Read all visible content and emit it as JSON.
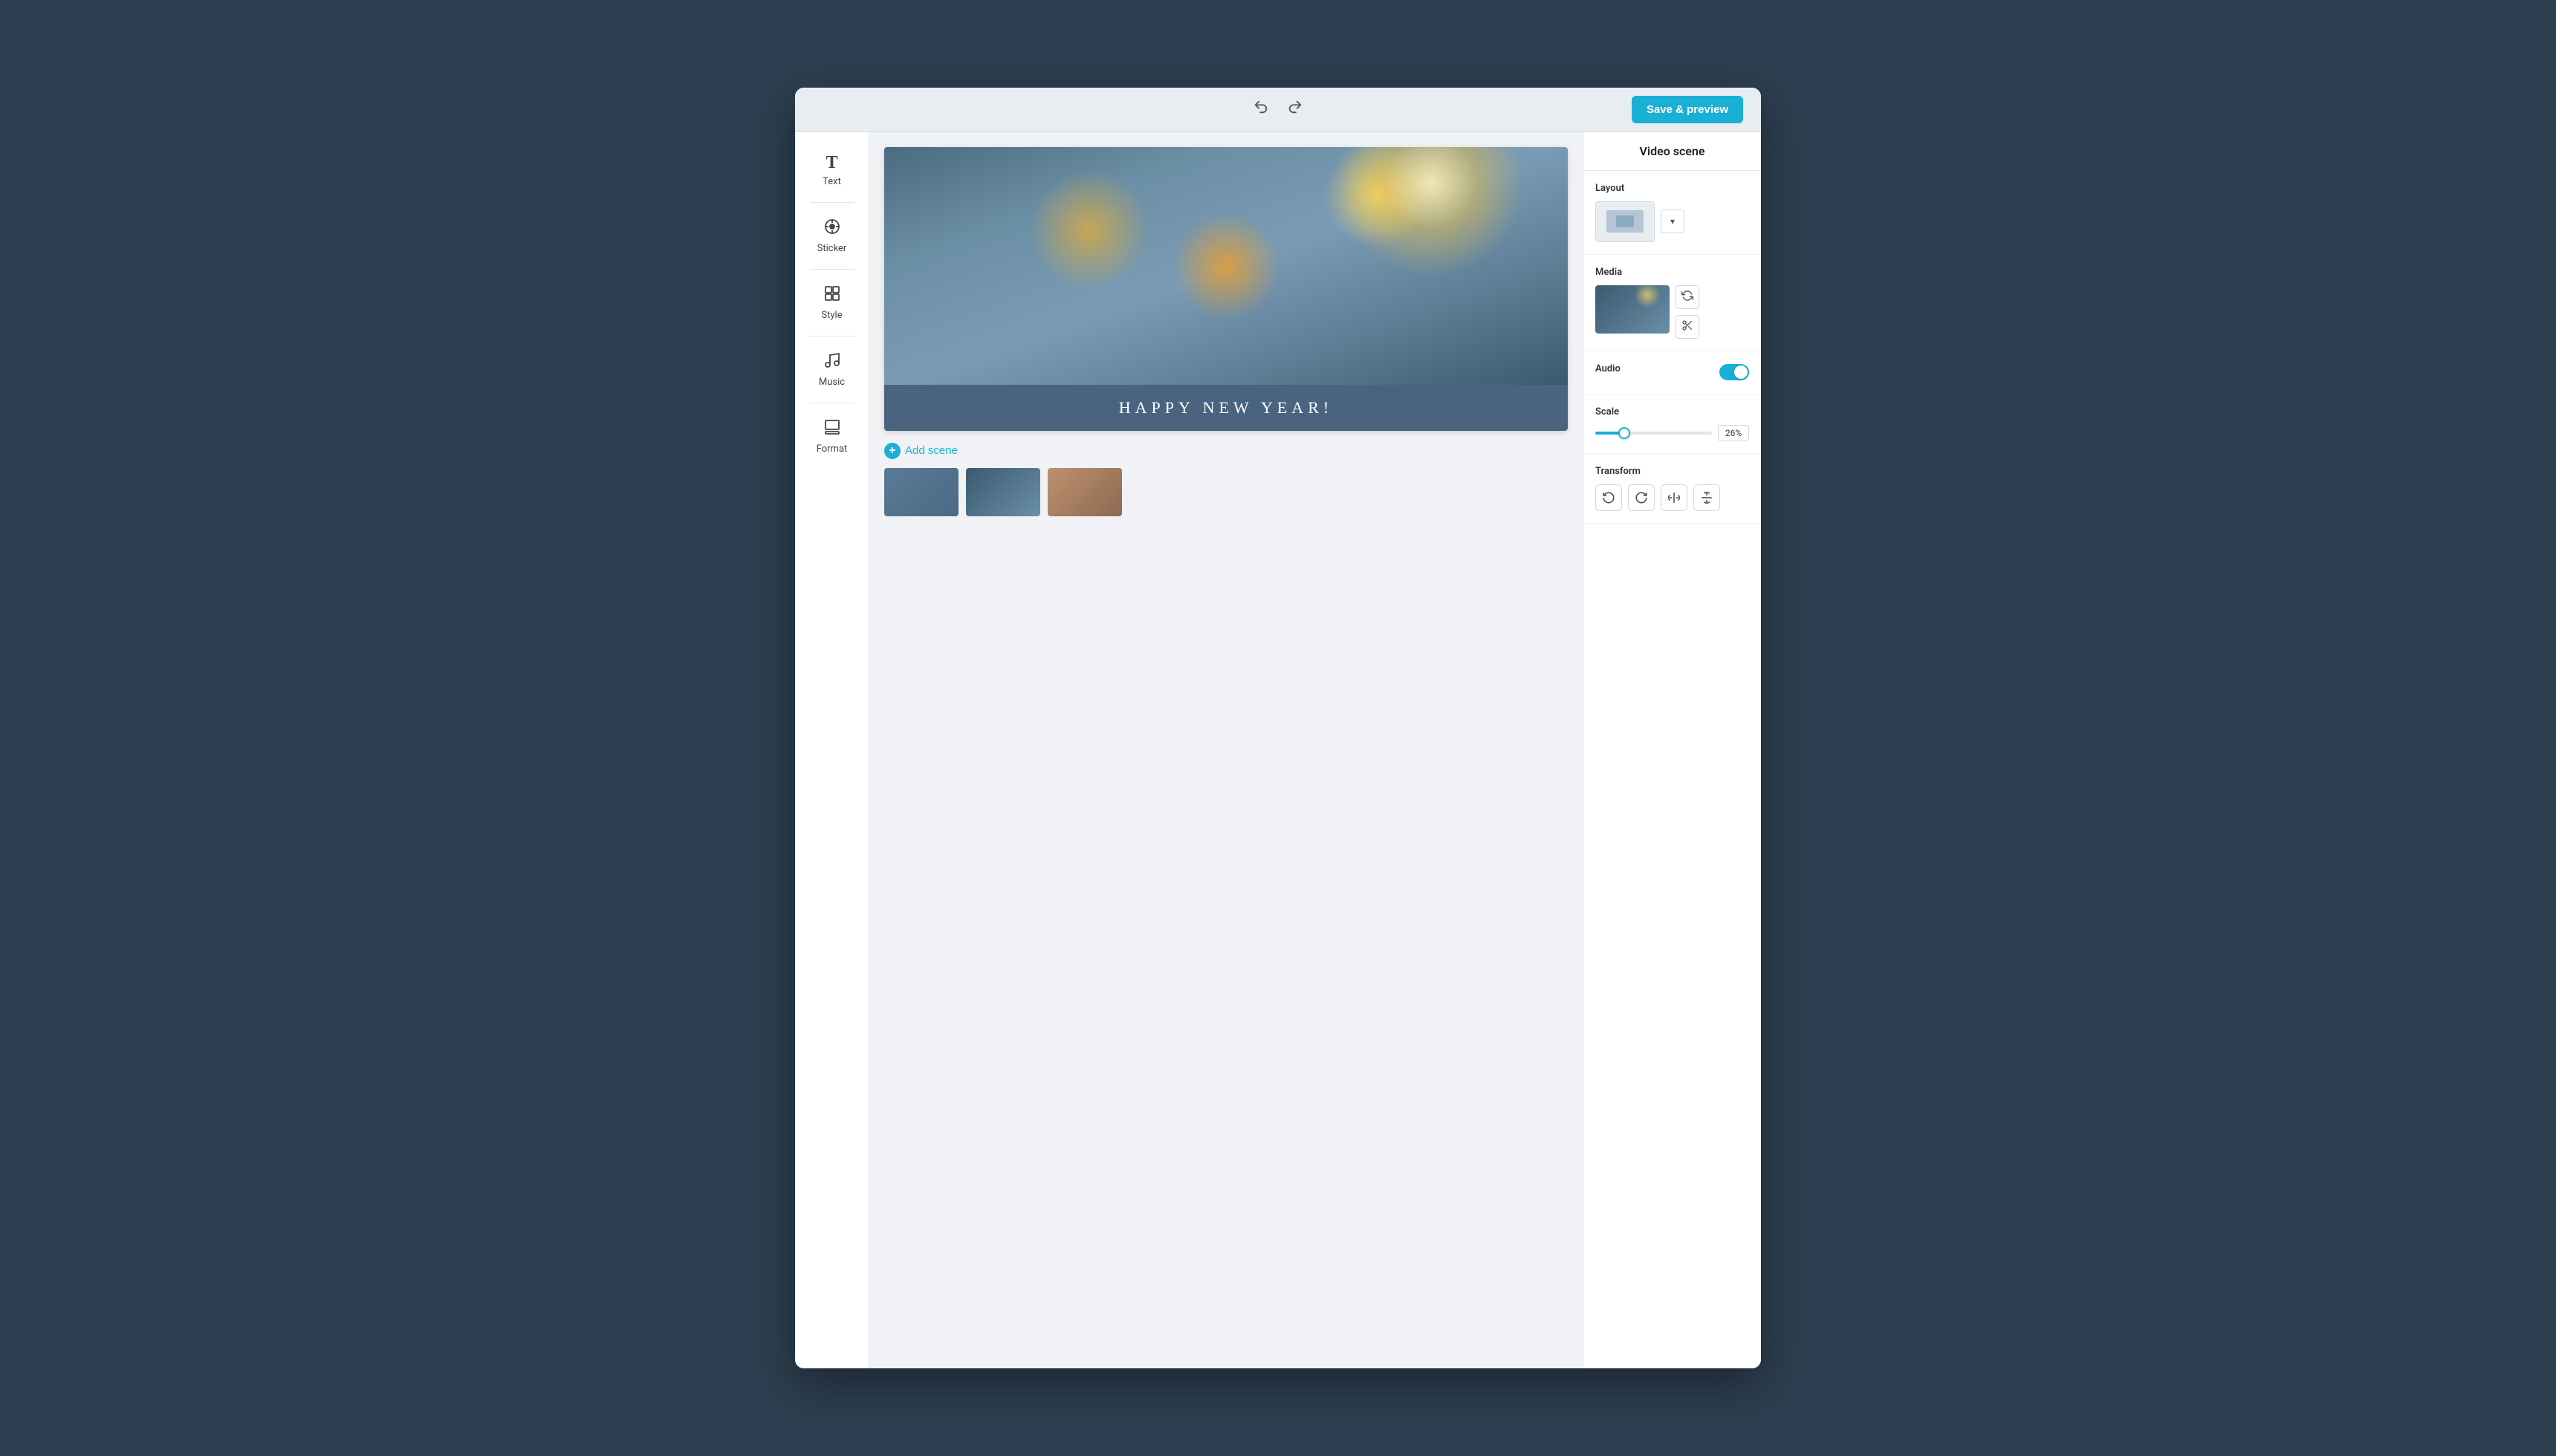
{
  "topbar": {
    "save_preview_label": "Save & preview"
  },
  "sidebar": {
    "items": [
      {
        "id": "text",
        "label": "Text",
        "icon": "T"
      },
      {
        "id": "sticker",
        "label": "Sticker",
        "icon": "⊙"
      },
      {
        "id": "style",
        "label": "Style",
        "icon": "⊞"
      },
      {
        "id": "music",
        "label": "Music",
        "icon": "♪"
      },
      {
        "id": "format",
        "label": "Format",
        "icon": "⊟"
      }
    ]
  },
  "canvas": {
    "scene_text": "HAPPY NEW YEAR!",
    "add_scene_label": "Add scene"
  },
  "right_panel": {
    "title": "Video scene",
    "layout": {
      "label": "Layout"
    },
    "media": {
      "label": "Media"
    },
    "audio": {
      "label": "Audio",
      "enabled": true
    },
    "scale": {
      "label": "Scale",
      "value": "26%",
      "percent": 26
    },
    "transform": {
      "label": "Transform"
    }
  }
}
